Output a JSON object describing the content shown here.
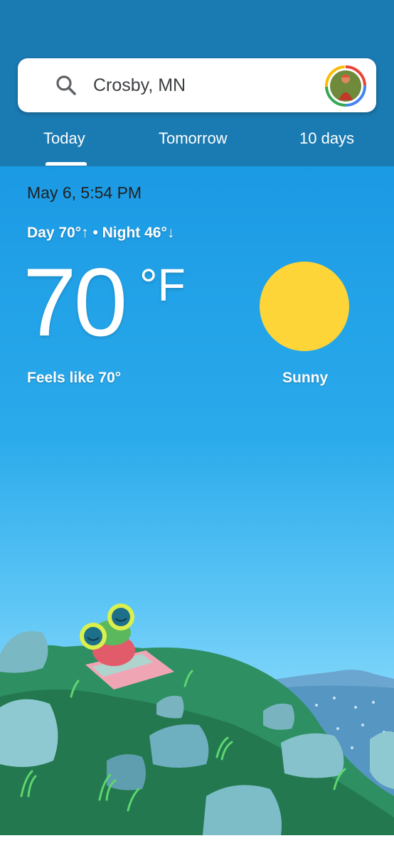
{
  "search": {
    "location": "Crosby, MN"
  },
  "tabs": [
    {
      "label": "Today",
      "selected": true
    },
    {
      "label": "Tomorrow",
      "selected": false
    },
    {
      "label": "10 days",
      "selected": false
    }
  ],
  "weather": {
    "datetime": "May 6, 5:54 PM",
    "day_night": "Day 70°↑ • Night 46°↓",
    "temperature": "70",
    "unit": "°F",
    "feels_like": "Feels like 70°",
    "condition": "Sunny",
    "condition_icon": "sun-icon"
  },
  "colors": {
    "header": "#1a7ab2",
    "sky_top": "#1b9ae4",
    "sun": "#fdd538"
  },
  "icons": {
    "search": "search-icon",
    "account": "avatar"
  }
}
